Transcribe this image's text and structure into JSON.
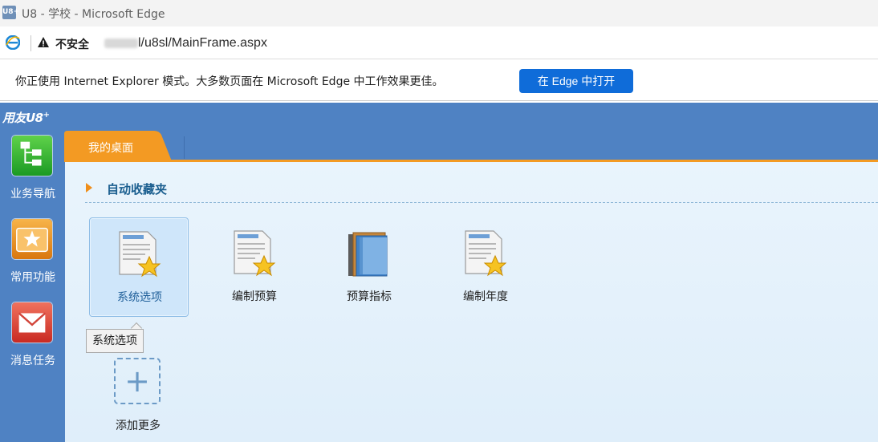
{
  "window": {
    "title": "U8 - 学校 - Microsoft Edge",
    "app_icon_text": "U8+"
  },
  "addressbar": {
    "security_label": "不安全",
    "url_visible": "l/u8sl/MainFrame.aspx"
  },
  "ie_mode_bar": {
    "message": "你正使用 Internet Explorer 模式。大多数页面在 Microsoft Edge 中工作效果更佳。",
    "open_button": "在 Edge 中打开"
  },
  "app": {
    "logo": "用友U8",
    "logo_sup": "+",
    "nav": [
      {
        "label": "业务导航",
        "icon": "business-navigation-icon"
      },
      {
        "label": "常用功能",
        "icon": "favorite-functions-icon"
      },
      {
        "label": "消息任务",
        "icon": "message-task-icon"
      }
    ],
    "tabs": [
      {
        "label": "我的桌面",
        "active": true
      }
    ],
    "section_title": "自动收藏夹",
    "favorites": [
      {
        "label": "系统选项",
        "icon": "document-star-icon",
        "selected": true
      },
      {
        "label": "编制预算",
        "icon": "document-star-icon",
        "selected": false
      },
      {
        "label": "预算指标",
        "icon": "books-icon",
        "selected": false
      },
      {
        "label": "编制年度",
        "icon": "document-star-icon",
        "selected": false
      }
    ],
    "tooltip": "系统选项",
    "add_more": "添加更多"
  },
  "colors": {
    "app_blue": "#4f82c3",
    "tab_orange": "#f39a23",
    "edge_button": "#0f6cd9",
    "panel_bg": "#e9f4fc"
  }
}
